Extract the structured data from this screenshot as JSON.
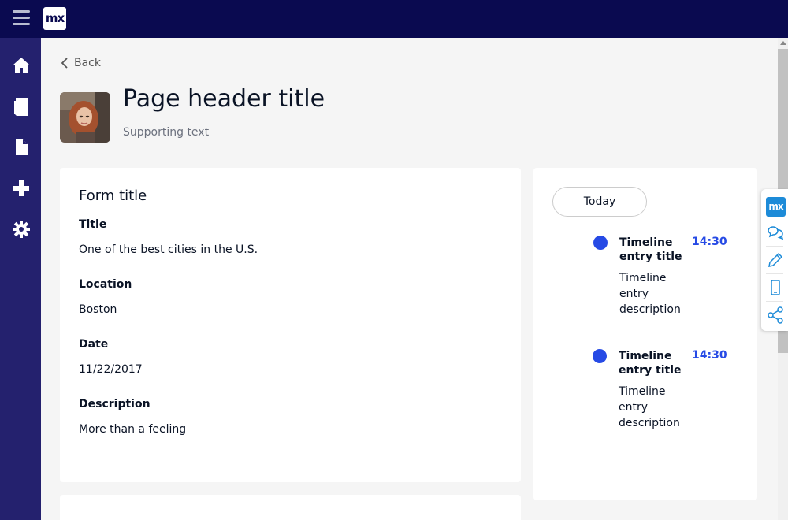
{
  "brand": {
    "logo_text": "mx"
  },
  "sidebar": {
    "items": [
      {
        "name": "home",
        "icon": "home-icon"
      },
      {
        "name": "book",
        "icon": "book-icon"
      },
      {
        "name": "file",
        "icon": "file-icon"
      },
      {
        "name": "add",
        "icon": "plus-icon"
      },
      {
        "name": "settings",
        "icon": "gear-icon"
      }
    ]
  },
  "header": {
    "back_label": "Back",
    "title": "Page header title",
    "subtitle": "Supporting text"
  },
  "form": {
    "title": "Form title",
    "fields": [
      {
        "label": "Title",
        "value": "One of the best cities in the U.S."
      },
      {
        "label": "Location",
        "value": "Boston"
      },
      {
        "label": "Date",
        "value": "11/22/2017"
      },
      {
        "label": "Description",
        "value": "More than a feeling"
      }
    ]
  },
  "timeline": {
    "today_label": "Today",
    "entries": [
      {
        "title": "Timeline entry title",
        "description": "Timeline entry description",
        "time": "14:30"
      },
      {
        "title": "Timeline entry title",
        "description": "Timeline entry description",
        "time": "14:30"
      }
    ]
  },
  "dock": {
    "logo_text": "mx",
    "items": [
      "chat-icon",
      "pencil-icon",
      "mobile-icon",
      "share-icon"
    ]
  },
  "colors": {
    "topbar": "#0a0a50",
    "sidebar": "#24216e",
    "accent": "#264ae5",
    "dock_logo": "#1d8bd8"
  }
}
